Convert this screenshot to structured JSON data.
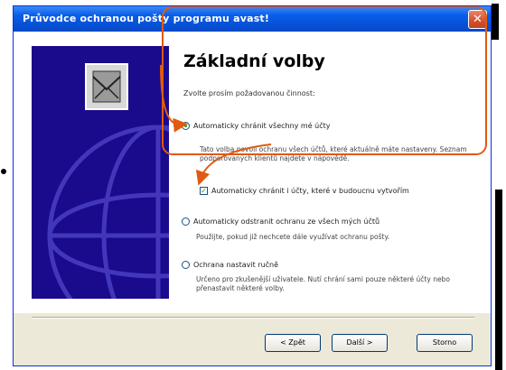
{
  "window": {
    "title": "Průvodce ochranou pošty programu avast!",
    "close_glyph": "✕"
  },
  "heading": "Základní volby",
  "intro": "Zvolte prosím požadovanou činnost:",
  "options": [
    {
      "label": "Automaticky chránit všechny mé účty",
      "selected": true,
      "description": "Tato volba povolí ochranu všech účtů, které aktuálně máte nastaveny. Seznam podporovaných klientů najdete v nápovědě."
    },
    {
      "label": "Automaticky odstranit ochranu ze všech mých účtů",
      "selected": false,
      "description": "Použijte, pokud již nechcete dále využívat ochranu pošty."
    },
    {
      "label": "Ochrana nastavit ručně",
      "selected": false,
      "description": "Určeno pro zkušenější uživatele. Nutí chrání sami pouze některé účty nebo přenastavit některé volby."
    }
  ],
  "checkbox": {
    "label": "Automaticky chránit i účty, které v budoucnu vytvořím",
    "checked": true
  },
  "buttons": {
    "back": "< Zpět",
    "next": "Další >",
    "cancel": "Storno"
  },
  "colors": {
    "titlebar": "#0553d8",
    "side_panel": "#1a0a8c",
    "callout": "#e05a12",
    "check": "#21a121"
  },
  "icons": {
    "side_image": "mail-envelope-icon",
    "close": "close-icon"
  }
}
